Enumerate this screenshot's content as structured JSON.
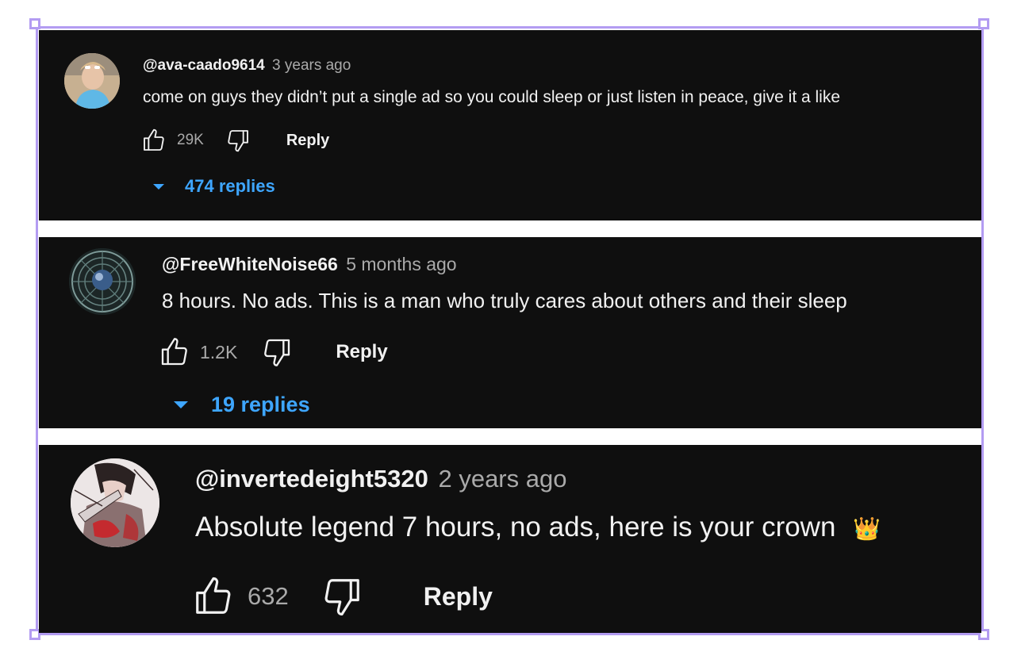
{
  "colors": {
    "card_background": "#0f0f0f",
    "text_primary": "#f1f1f1",
    "text_secondary": "#aaaaaa",
    "link_blue": "#3ea6ff",
    "frame_purple": "#b39cf2"
  },
  "comments": [
    {
      "author": "@ava-caado9614",
      "time": "3 years ago",
      "text": "come on guys they didn’t put a single ad so you could sleep or just listen in peace, give it a like",
      "likes": "29K",
      "reply_label": "Reply",
      "replies_label": "474 replies",
      "avatar_icon": "child-portrait-avatar"
    },
    {
      "author": "@FreeWhiteNoise66",
      "time": "5 months ago",
      "text": "8 hours. No ads. This is a man who truly cares about others and their sleep",
      "likes": "1.2K",
      "reply_label": "Reply",
      "replies_label": "19 replies",
      "avatar_icon": "fan-avatar"
    },
    {
      "author": "@invertedeight5320",
      "time": "2 years ago",
      "text": "Absolute legend 7 hours, no ads, here is your crown",
      "emoji": "👑",
      "likes": "632",
      "reply_label": "Reply",
      "avatar_icon": "anime-art-avatar"
    }
  ]
}
